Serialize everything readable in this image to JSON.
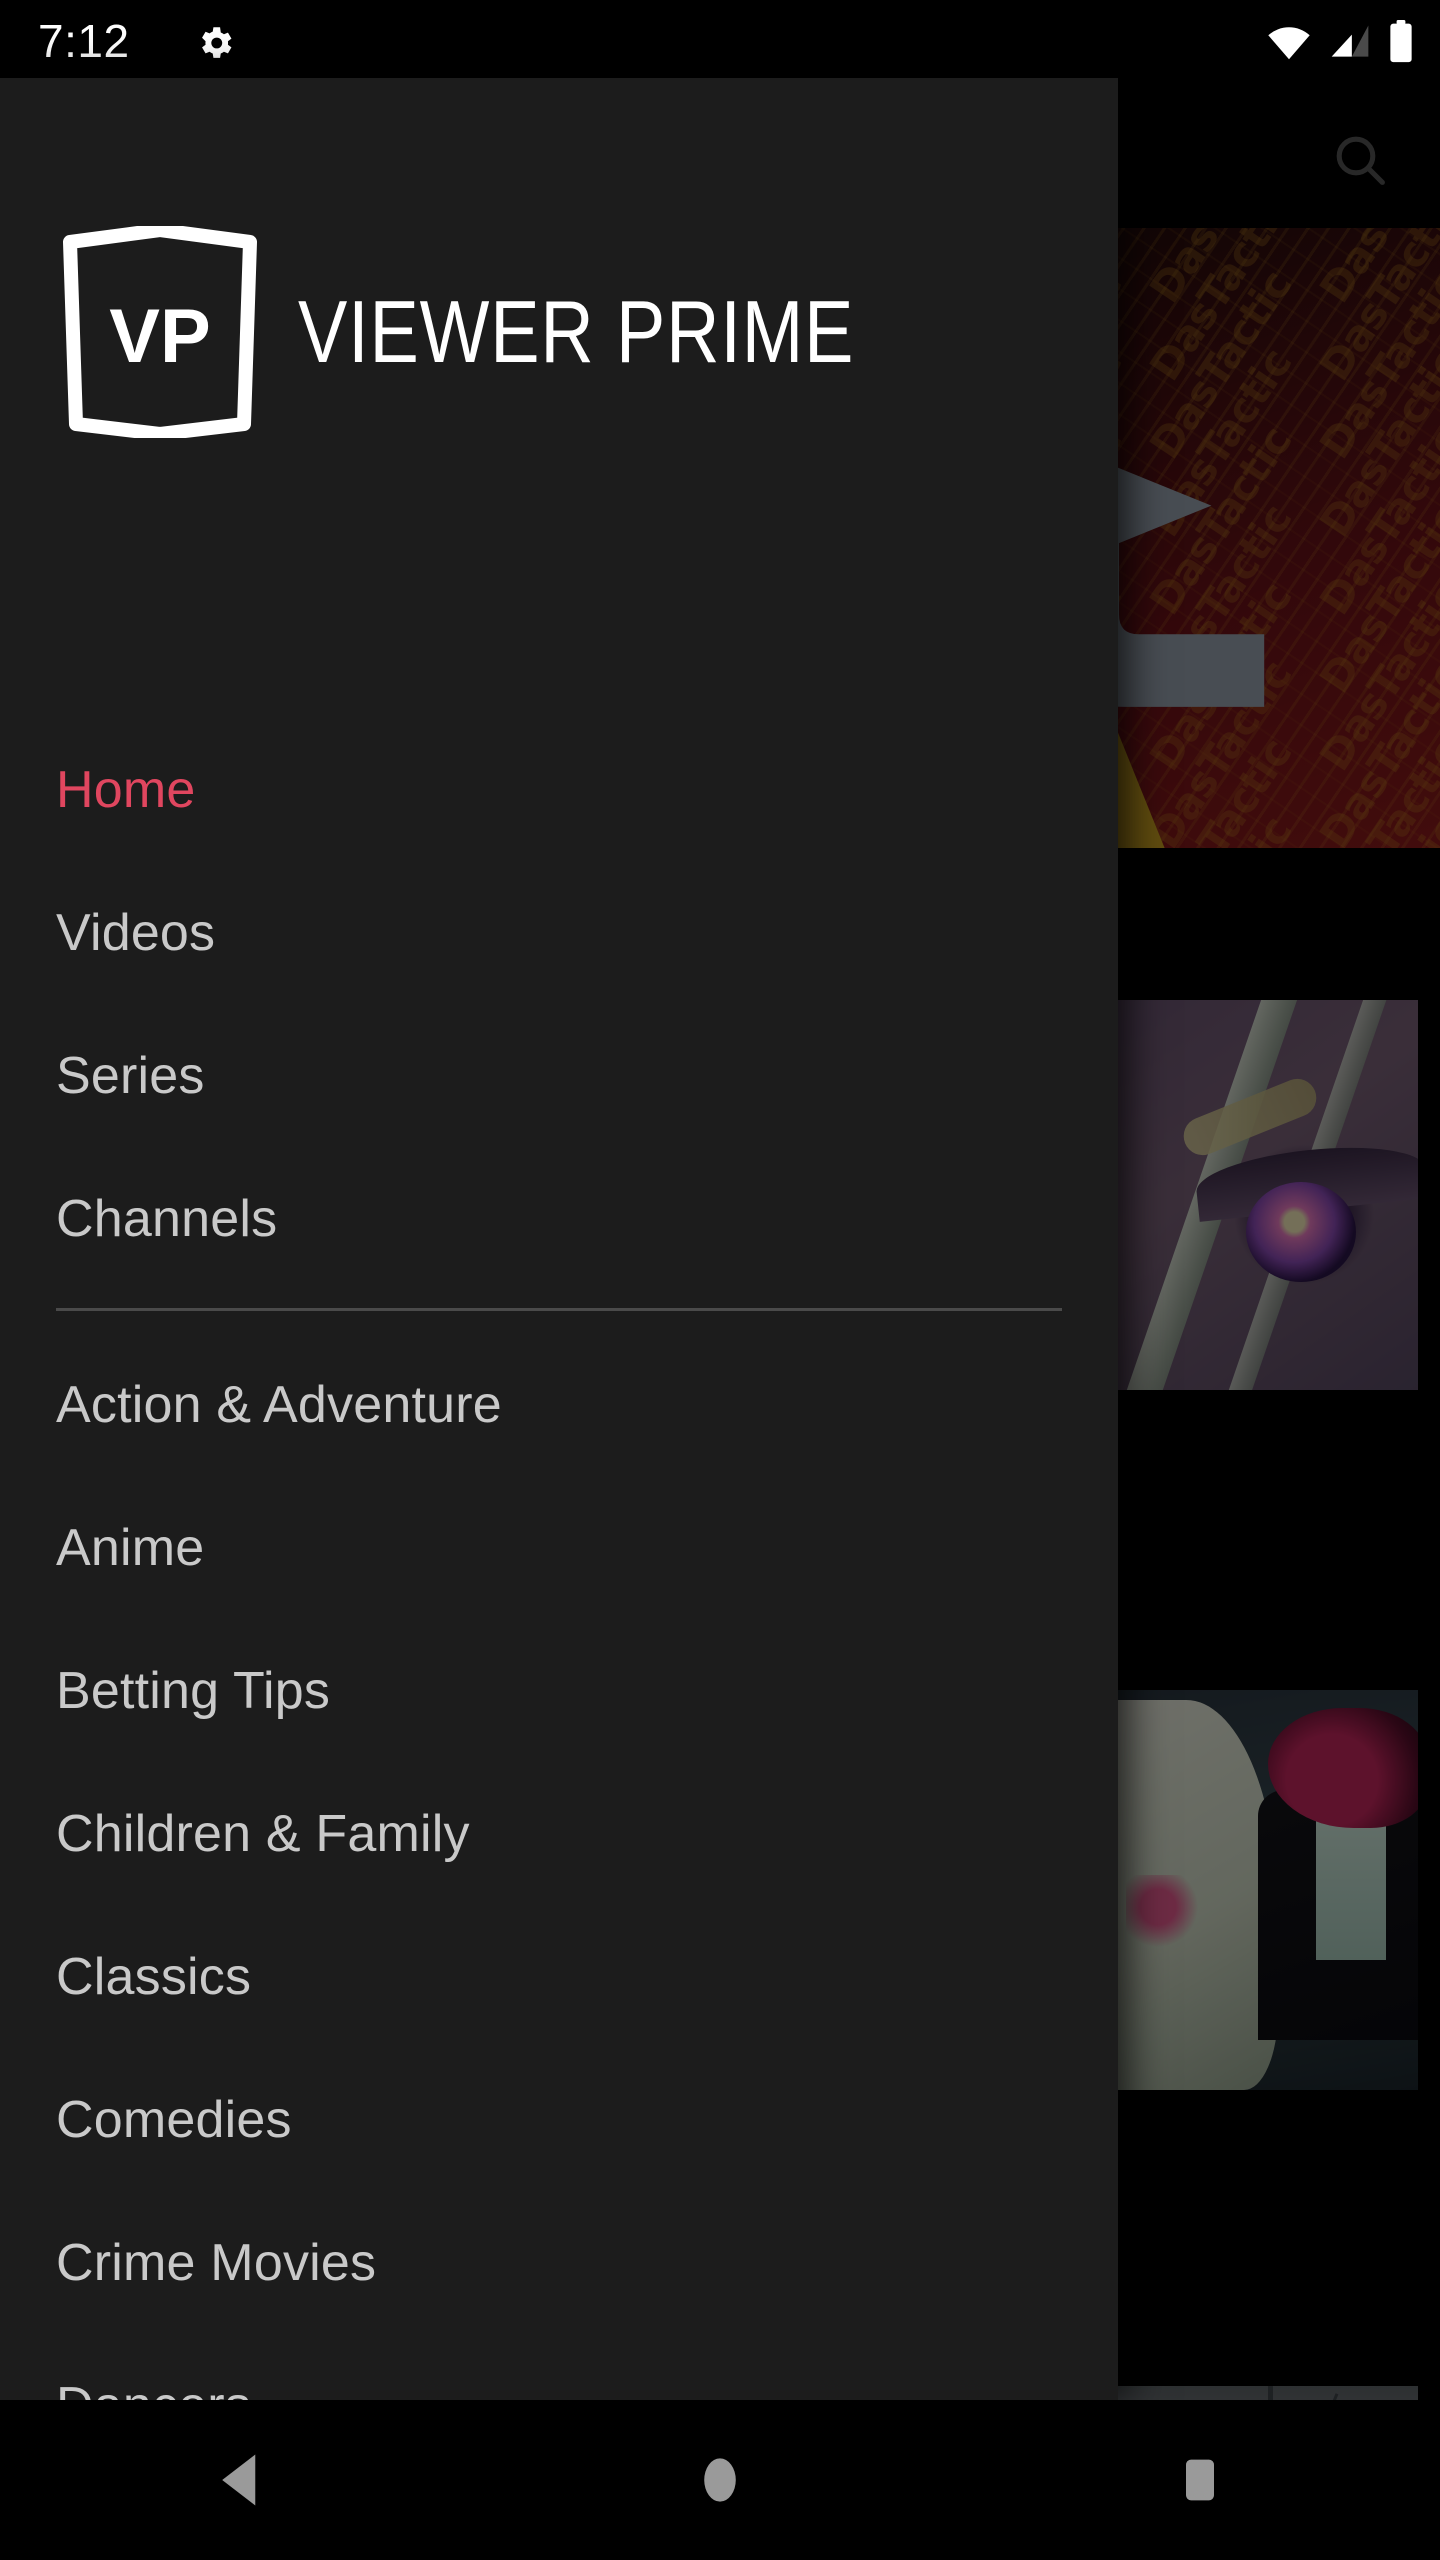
{
  "status_bar": {
    "clock": "7:12",
    "gear_icon": "gear-icon",
    "wifi_icon": "wifi-icon",
    "cellular_icon": "cellular-signal-icon",
    "battery_icon": "battery-full-icon"
  },
  "app_bar": {
    "search_icon": "search-icon",
    "search_label": "Search"
  },
  "drawer": {
    "logo_initials": "VP",
    "logo_text": "VIEWER PRIME",
    "primary_items": [
      {
        "label": "Home",
        "active": true
      },
      {
        "label": "Videos",
        "active": false
      },
      {
        "label": "Series",
        "active": false
      },
      {
        "label": "Channels",
        "active": false
      }
    ],
    "category_items": [
      {
        "label": "Action & Adventure"
      },
      {
        "label": "Anime"
      },
      {
        "label": "Betting Tips"
      },
      {
        "label": "Children & Family"
      },
      {
        "label": "Classics"
      },
      {
        "label": "Comedies"
      },
      {
        "label": "Crime Movies"
      },
      {
        "label": "Dancers"
      }
    ]
  },
  "content": {
    "hero": {
      "watermark_text": "DasTactic",
      "logo_icon": "curved-arrow-icon",
      "mask_icon": "jester-mask-icon"
    },
    "thumbnails": [
      {
        "name": "thumb-anime-eye"
      },
      {
        "name": "thumb-anime-characters"
      },
      {
        "name": "thumb-winter-scene"
      }
    ]
  },
  "nav_bar": {
    "back_icon": "back-triangle-icon",
    "home_icon": "home-circle-icon",
    "recents_icon": "recents-square-icon"
  },
  "colors": {
    "accent": "#e0465f",
    "drawer_bg": "#1c1c1c",
    "label": "#c9c9c9",
    "divider": "#4a4a4a",
    "nav_icon": "#9a9a9a",
    "hero_red": "#8a1a1c",
    "hero_yellow": "#c8a020"
  }
}
